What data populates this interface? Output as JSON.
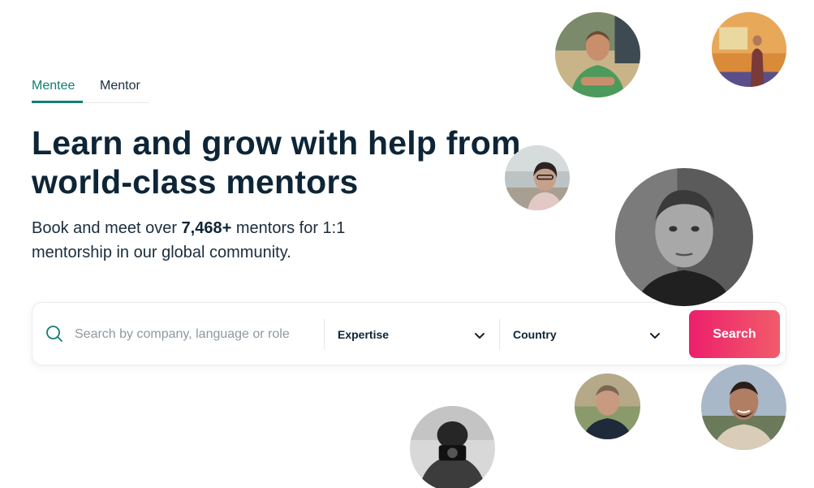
{
  "tabs": {
    "mentee": "Mentee",
    "mentor": "Mentor"
  },
  "hero": {
    "headline_line1": "Learn and grow with help from",
    "headline_line2": "world-class mentors",
    "sub_prefix": "Book and meet over ",
    "sub_count": "7,468+",
    "sub_suffix": " mentors for 1:1 mentorship in our global community."
  },
  "search": {
    "placeholder": "Search by company, language or role",
    "expertise_label": "Expertise",
    "country_label": "Country",
    "button_label": "Search"
  },
  "colors": {
    "accent_green": "#127e74",
    "button_pink": "#ec1f6c",
    "heading": "#0d2537"
  },
  "avatars": [
    "mentor-avatar-green-shirt",
    "mentor-avatar-speaker",
    "mentor-avatar-beach",
    "mentor-avatar-portrait-bw",
    "mentor-avatar-dark-shirt",
    "mentor-avatar-smiling",
    "mentor-avatar-camera-bw"
  ]
}
